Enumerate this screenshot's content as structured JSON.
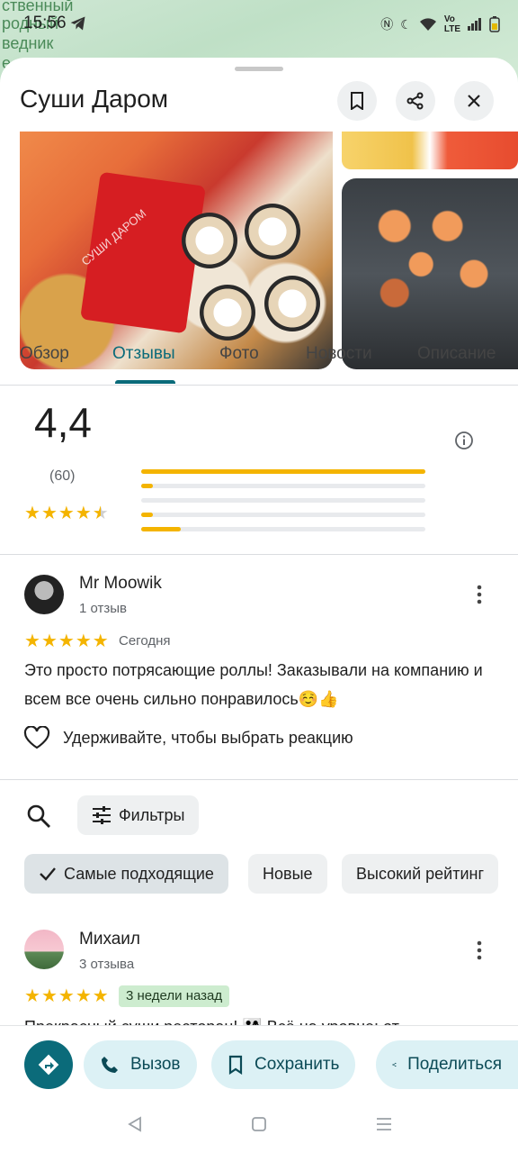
{
  "status_bar": {
    "time": "15:56",
    "map_labels": [
      "ственный",
      "родный",
      "ведник",
      "е"
    ]
  },
  "place": {
    "title": "Суши Даром",
    "photo_watermark": "СУШИ ДАРОМ"
  },
  "tabs": [
    {
      "label": "Обзор",
      "active": false
    },
    {
      "label": "Отзывы",
      "active": true
    },
    {
      "label": "Фото",
      "active": false
    },
    {
      "label": "Новости",
      "active": false
    },
    {
      "label": "Описание",
      "active": false
    }
  ],
  "rating": {
    "average": "4,4",
    "count": "(60)",
    "stars_value": 4.4,
    "distribution": [
      {
        "stars": 5,
        "fraction": 1.0
      },
      {
        "stars": 4,
        "fraction": 0.04
      },
      {
        "stars": 3,
        "fraction": 0.0
      },
      {
        "stars": 2,
        "fraction": 0.04
      },
      {
        "stars": 1,
        "fraction": 0.14
      }
    ]
  },
  "review1": {
    "name": "Mr Moowik",
    "sub": "1 отзыв",
    "stars": 5,
    "date": "Сегодня",
    "text": "Это просто потрясающие роллы! Заказывали на компанию и всем все очень сильно понравилось☺️👍",
    "reaction_label": "Удерживайте, чтобы выбрать реакцию"
  },
  "filters": {
    "filter_label": "Фильтры",
    "chips": [
      {
        "label": "Самые подходящие",
        "selected": true
      },
      {
        "label": "Новые",
        "selected": false
      },
      {
        "label": "Высокий рейтинг",
        "selected": false
      }
    ]
  },
  "review2": {
    "name": "Михаил",
    "sub": "3 отзыва",
    "stars": 5,
    "date": "3 недели назад",
    "text": "Прекрасный суши ресторан! 👨‍👩‍👧 Всё на уровне: от"
  },
  "actions": {
    "call": "Вызов",
    "save": "Сохранить",
    "share": "Поделиться"
  },
  "colors": {
    "accent": "#0b6b7a",
    "star": "#f4b400",
    "chip_bg": "#eef0f1",
    "pill_bg": "#dcf1f5"
  }
}
